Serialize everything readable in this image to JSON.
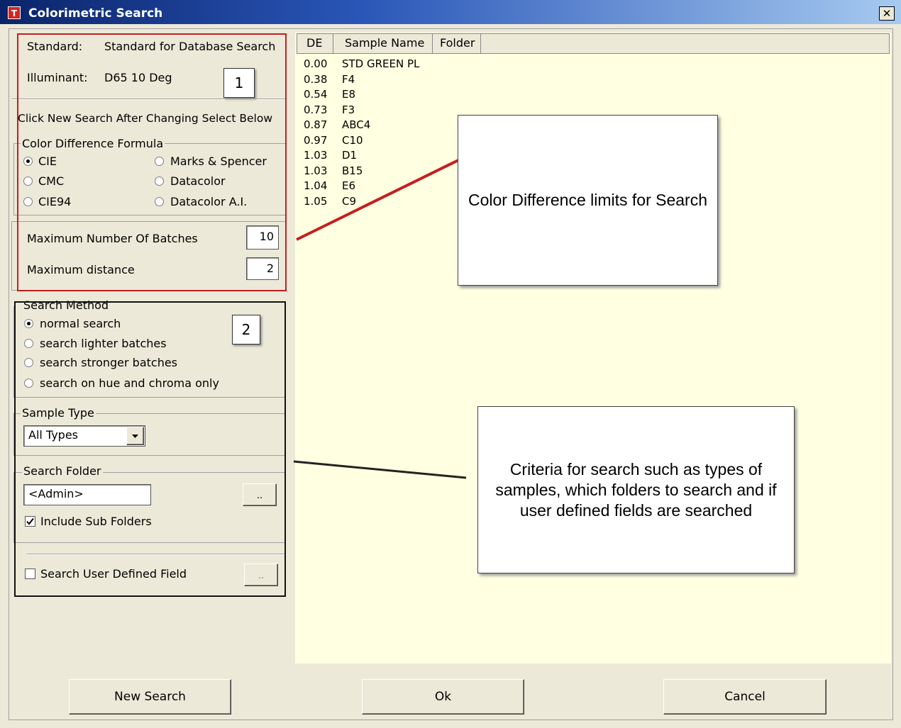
{
  "window": {
    "title": "Colorimetric Search",
    "logo_letter": "T",
    "close_glyph": "✕"
  },
  "standard": {
    "label": "Standard:",
    "value": "Standard for Database Search"
  },
  "illuminant": {
    "label": "Illuminant:",
    "value": "D65 10 Deg"
  },
  "instruction": "Click New Search After Changing Select Below",
  "formula": {
    "legend": "Color Difference Formula",
    "options": [
      "CIE",
      "Marks & Spencer",
      "CMC",
      "Datacolor",
      "CIE94",
      "Datacolor A.I."
    ],
    "selected": "CIE"
  },
  "limits": {
    "max_batches_label": "Maximum Number Of Batches",
    "max_batches_value": "10",
    "max_distance_label": "Maximum distance",
    "max_distance_value": "2"
  },
  "search_method": {
    "legend": "Search Method",
    "options": [
      "normal search",
      "search lighter batches",
      "search stronger batches",
      "search on hue and chroma only"
    ],
    "selected": "normal search"
  },
  "sample_type": {
    "legend": "Sample Type",
    "value": "All Types"
  },
  "search_folder": {
    "legend": "Search Folder",
    "value": "<Admin>",
    "browse_label": "..",
    "include_sub_label": "Include Sub Folders",
    "include_sub_checked": true
  },
  "user_defined": {
    "label": "Search User Defined Field",
    "checked": false,
    "browse_label": ".."
  },
  "results": {
    "columns": [
      "DE",
      "Sample Name",
      "Folder"
    ],
    "rows": [
      {
        "de": "0.00",
        "name": "STD GREEN PL"
      },
      {
        "de": "0.38",
        "name": "F4"
      },
      {
        "de": "0.54",
        "name": "E8"
      },
      {
        "de": "0.73",
        "name": "F3"
      },
      {
        "de": "0.87",
        "name": "ABC4"
      },
      {
        "de": "0.97",
        "name": "C10"
      },
      {
        "de": "1.03",
        "name": "D1"
      },
      {
        "de": "1.03",
        "name": "B15"
      },
      {
        "de": "1.04",
        "name": "E6"
      },
      {
        "de": "1.05",
        "name": "C9"
      }
    ]
  },
  "annotations": {
    "label1": "1",
    "label2": "2",
    "note1": "Color Difference limits for Search",
    "note2": "Criteria for search such as types of samples, which folders to search and if user defined fields are searched",
    "note1_color": "#c41f1f",
    "note2_color": "#111111"
  },
  "buttons": {
    "new_search": "New Search",
    "ok": "Ok",
    "cancel": "Cancel"
  },
  "icons": {
    "dropdown": "chevron-down-icon",
    "check": "checkmark-icon",
    "radio": "radio-dot-icon"
  }
}
